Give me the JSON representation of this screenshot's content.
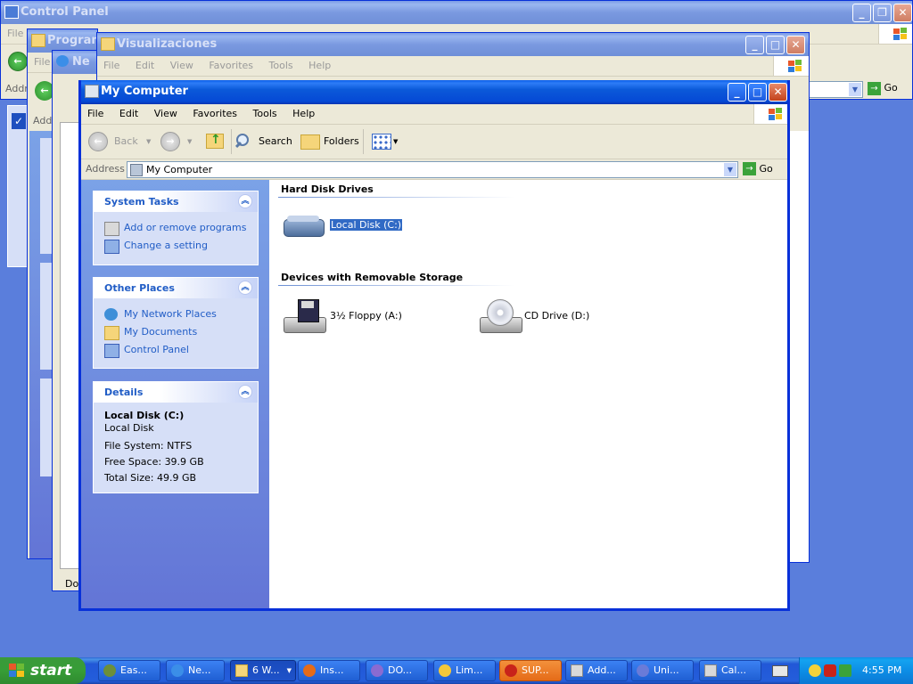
{
  "windows": {
    "control_panel": {
      "title": "Control Panel",
      "menu_fragment": "File",
      "address_fragment": "Addr",
      "go_label": "Go"
    },
    "programs": {
      "title": "Program",
      "menu_fragment": "File",
      "address_fragment": "Add",
      "bottom_fragment": "Do"
    },
    "network": {
      "title": "Ne"
    },
    "visualizaciones": {
      "title": "Visualizaciones",
      "menu": [
        "File",
        "Edit",
        "View",
        "Favorites",
        "Tools",
        "Help"
      ]
    }
  },
  "my_computer": {
    "title": "My Computer",
    "menu": [
      "File",
      "Edit",
      "View",
      "Favorites",
      "Tools",
      "Help"
    ],
    "toolbar": {
      "back": "Back",
      "search": "Search",
      "folders": "Folders"
    },
    "address": {
      "label": "Address",
      "value": "My Computer",
      "go": "Go"
    },
    "system_tasks": {
      "title": "System Tasks",
      "items": [
        "Add or remove programs",
        "Change a setting"
      ]
    },
    "other_places": {
      "title": "Other Places",
      "items": [
        "My Network Places",
        "My Documents",
        "Control Panel"
      ]
    },
    "details": {
      "title": "Details",
      "name": "Local Disk (C:)",
      "type": "Local Disk",
      "file_system": "File System: NTFS",
      "free_space": "Free Space: 39.9 GB",
      "total_size": "Total Size: 49.9 GB"
    },
    "sections": {
      "hard_disks": {
        "title": "Hard Disk Drives",
        "items": [
          "Local Disk (C:)"
        ]
      },
      "removable": {
        "title": "Devices with Removable Storage",
        "items": [
          "3½ Floppy (A:)",
          "CD Drive (D:)"
        ]
      }
    }
  },
  "taskbar": {
    "start": "start",
    "buttons": [
      "Eas...",
      "Ne...",
      "6 W...",
      "Ins...",
      "DO...",
      "Lim...",
      "SUP...",
      "Add...",
      "Uni...",
      "Cal..."
    ],
    "clock": "4:55 PM"
  },
  "colors": {
    "desktop": "#5a7edc",
    "title_active": "#0b59d9",
    "link": "#215dc6",
    "selection": "#316ac5",
    "start_green": "#379d37",
    "sup_orange": "#e56b18"
  }
}
